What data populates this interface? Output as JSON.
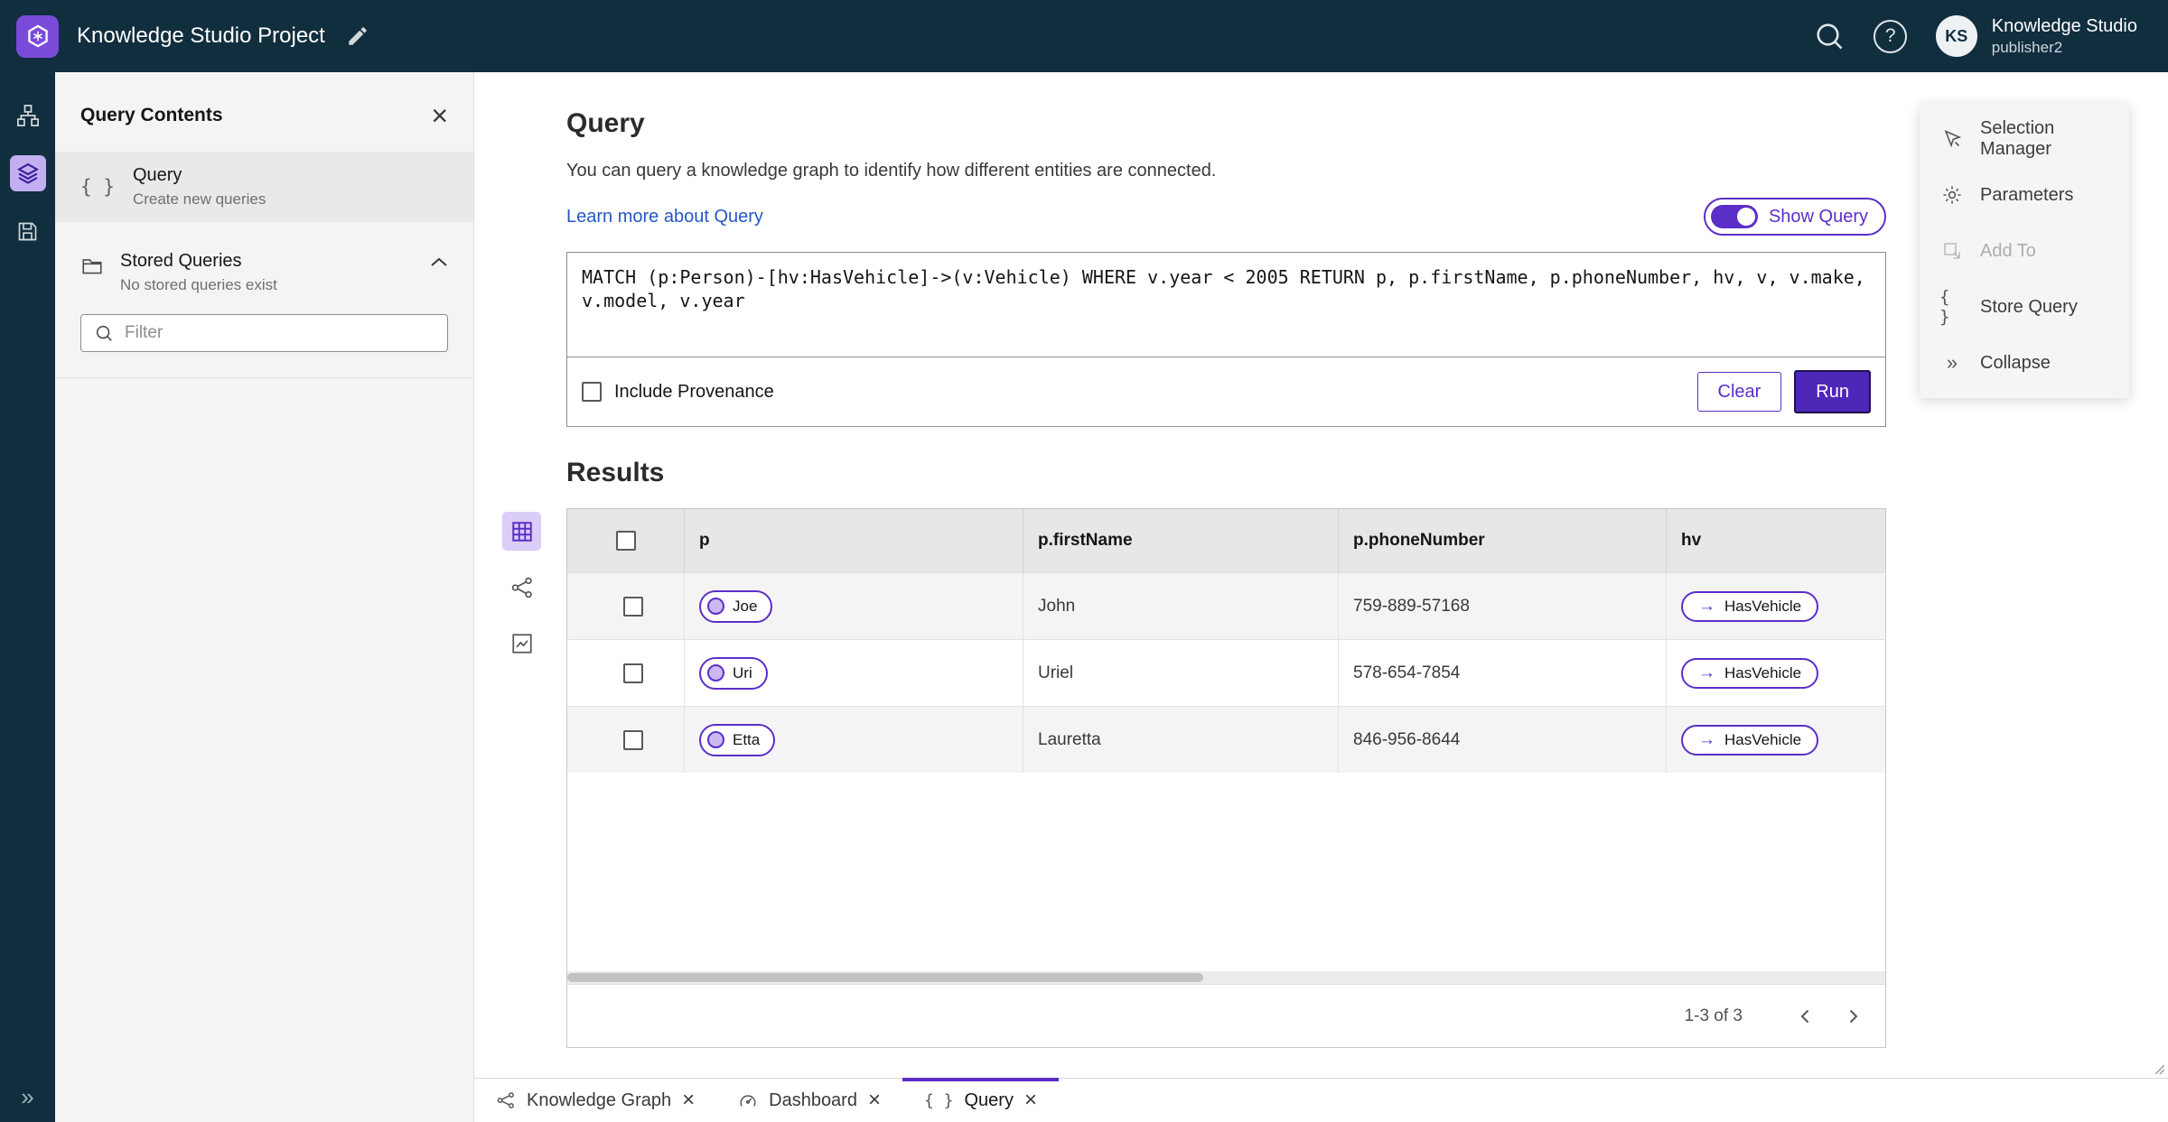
{
  "colors": {
    "accent": "#5b2ec8",
    "topbar": "#112e3f"
  },
  "icons": {
    "close": "×",
    "collapse": "»",
    "expand": "»",
    "braces": "{ }",
    "arrow_right": "→",
    "help": "?"
  },
  "topbar": {
    "title": "Knowledge Studio Project",
    "user_name": "Knowledge Studio",
    "user_role": "publisher2",
    "avatar_initials": "KS"
  },
  "sidebar": {
    "title": "Query Contents",
    "query_item": {
      "title": "Query",
      "subtitle": "Create new queries"
    },
    "stored_queries": {
      "title": "Stored Queries",
      "subtitle": "No stored queries exist"
    },
    "filter_placeholder": "Filter"
  },
  "query_panel": {
    "heading": "Query",
    "description": "You can query a knowledge graph to identify how different entities are connected.",
    "learn_more_link": "Learn more about Query",
    "show_query_label": "Show Query",
    "query_text": "MATCH (p:Person)-[hv:HasVehicle]->(v:Vehicle) WHERE v.year < 2005 RETURN p, p.firstName, p.phoneNumber, hv, v, v.make, v.model, v.year",
    "include_provenance_label": "Include Provenance",
    "clear_button": "Clear",
    "run_button": "Run"
  },
  "results": {
    "heading": "Results",
    "columns": [
      "p",
      "p.firstName",
      "p.phoneNumber",
      "hv"
    ],
    "rows": [
      {
        "p": "Joe",
        "firstName": "John",
        "phone": "759-889-57168",
        "hv": "HasVehicle"
      },
      {
        "p": "Uri",
        "firstName": "Uriel",
        "phone": "578-654-7854",
        "hv": "HasVehicle"
      },
      {
        "p": "Etta",
        "firstName": "Lauretta",
        "phone": "846-956-8644",
        "hv": "HasVehicle"
      }
    ],
    "pagination_label": "1-3 of 3"
  },
  "right_menu": {
    "selection_manager": "Selection Manager",
    "parameters": "Parameters",
    "add_to": "Add To",
    "store_query": "Store Query",
    "collapse": "Collapse"
  },
  "tabs": [
    {
      "label": "Knowledge Graph"
    },
    {
      "label": "Dashboard"
    },
    {
      "label": "Query"
    }
  ]
}
